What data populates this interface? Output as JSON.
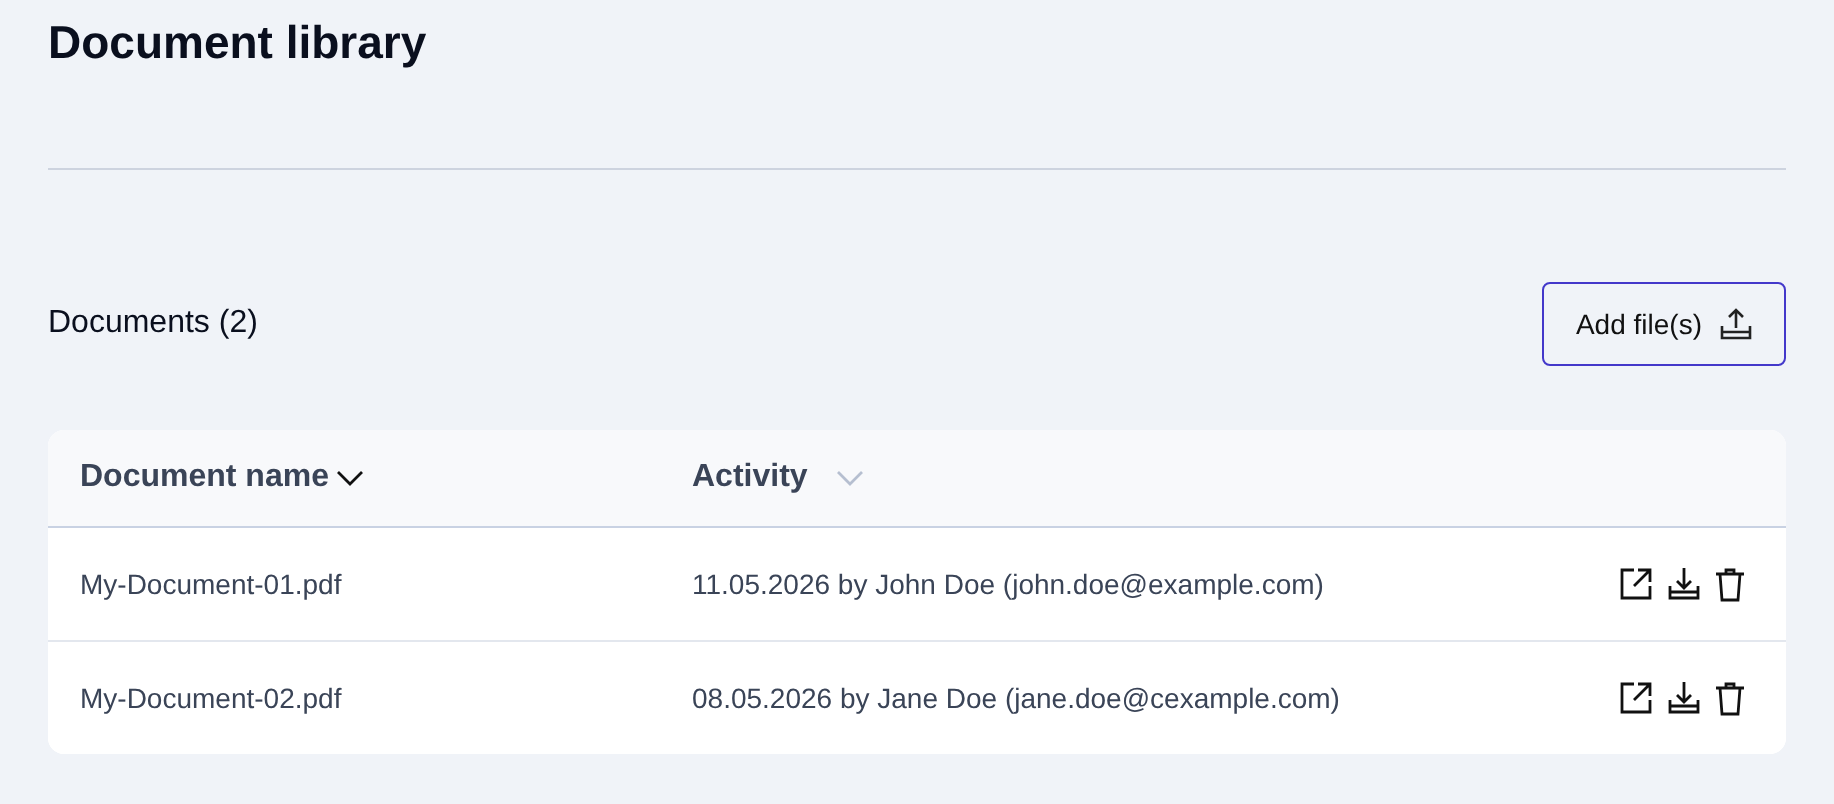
{
  "page": {
    "title": "Document library"
  },
  "documents": {
    "heading": "Documents (2)",
    "add_button": "Add file(s)"
  },
  "table": {
    "columns": [
      {
        "label": "Document name",
        "selected": true
      },
      {
        "label": "Activity",
        "selected": false
      }
    ],
    "rows": [
      {
        "name": "My-Document-01.pdf",
        "activity": "11.05.2026 by John Doe (john.doe@example.com)"
      },
      {
        "name": "My-Document-02.pdf",
        "activity": "08.05.2026 by Jane Doe (jane.doe@cexample.com)"
      }
    ]
  }
}
